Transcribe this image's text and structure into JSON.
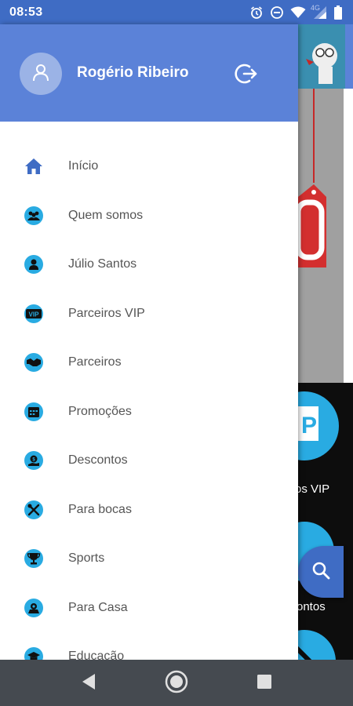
{
  "status_bar": {
    "time": "08:53",
    "network_label": "4G",
    "icons": [
      "alarm-icon",
      "do-not-disturb-icon",
      "wifi-icon",
      "cell-signal-icon",
      "battery-icon"
    ]
  },
  "drawer": {
    "header": {
      "user_name": "Rogério Ribeiro",
      "avatar_icon": "person-icon",
      "logout_icon": "logout-icon"
    },
    "menu_items": [
      {
        "label": "Início",
        "icon": "home-icon"
      },
      {
        "label": "Quem somos",
        "icon": "people-icon"
      },
      {
        "label": "Júlio Santos",
        "icon": "person-icon"
      },
      {
        "label": "Parceiros VIP",
        "icon": "vip-icon"
      },
      {
        "label": "Parceiros",
        "icon": "handshake-icon"
      },
      {
        "label": "Promoções",
        "icon": "calendar-icon"
      },
      {
        "label": "Descontos",
        "icon": "discount-icon"
      },
      {
        "label": "Para bocas",
        "icon": "cutlery-icon"
      },
      {
        "label": "Sports",
        "icon": "trophy-icon"
      },
      {
        "label": "Para Casa",
        "icon": "house-icon"
      },
      {
        "label": "Educação",
        "icon": "graduation-cap-icon"
      }
    ]
  },
  "background": {
    "tile_label_1": "os VIP",
    "tile_label_2": "ontos",
    "fab_icon": "search-icon"
  },
  "nav_bar": {
    "icons": [
      "back-icon",
      "home-circle-icon",
      "recents-icon"
    ]
  },
  "colors": {
    "status_bar": "#3f6cc4",
    "drawer_header": "#5b82d8",
    "icon_accent": "#29abe2",
    "menu_text": "#555555",
    "nav_bar": "#454a50"
  }
}
